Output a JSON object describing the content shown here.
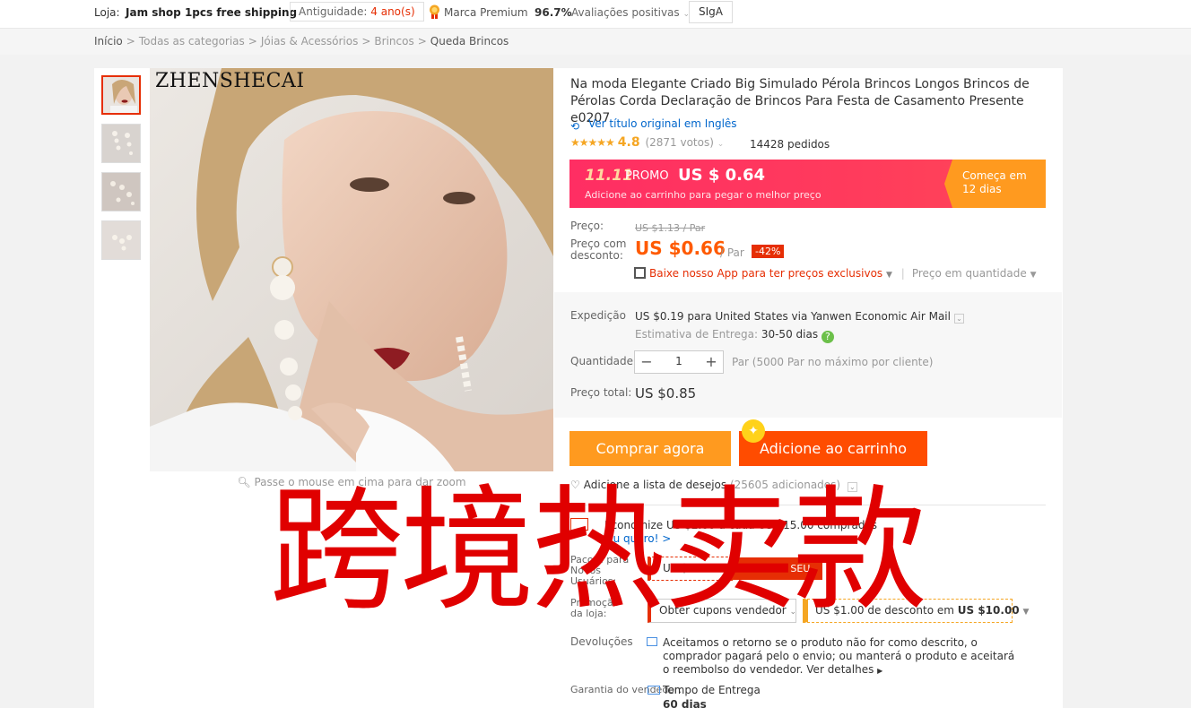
{
  "store_bar": {
    "store_label": "Loja:",
    "store_name": "Jam shop 1pcs free shipping",
    "age_label": "Antiguidade:",
    "age_value": "4 ano(s)",
    "premium_label": "Marca Premium",
    "positive_pct": "96.7%",
    "reviews_label": "Avaliações positivas",
    "follow_label": "SIgA"
  },
  "breadcrumb": {
    "items": [
      "Início",
      "Todas as categorias",
      "Jóias & Acessórios",
      "Brincos",
      "Queda Brincos"
    ]
  },
  "gallery": {
    "brand_text": "ZHENSHECAI",
    "zoom_hint": "Passe o mouse em cima para dar zoom"
  },
  "product": {
    "title": "Na moda Elegante Criado Big Simulado Pérola Brincos Longos Brincos de Pérolas Corda Declaração de Brincos Para Festa de Casamento Presente e0207",
    "translate_link": "Ver título original em Inglês",
    "stars": "★★★★★",
    "rating": "4.8",
    "votes": "(2871 votos)",
    "orders": "14428 pedidos"
  },
  "promo": {
    "badge": "11.11",
    "label": "PROMO",
    "price": "US $ 0.64",
    "subtext": "Adicione ao carrinho para pegar o melhor preço",
    "starts_line1": "Começa em",
    "starts_line2": "12 dias"
  },
  "pricing": {
    "price_label": "Preço:",
    "original_price": "US $1.13 / Par",
    "discount_label": "Preço com desconto:",
    "discount_price": "US $0.66",
    "per_unit": "/ Par",
    "discount_pct": "-42%",
    "app_promo": "Baixe nosso App para ter preços exclusivos",
    "bulk_price": "Preço em quantidade"
  },
  "shipping": {
    "label": "Expedição",
    "cost": "US $0.19 para",
    "destination": "United States via Yanwen Economic Air Mail",
    "estimate_label": "Estimativa de Entrega:",
    "estimate_days": "30-50 dias",
    "qty_label": "Quantidade",
    "qty_value": "1",
    "qty_note": "Par (5000 Par no máximo por cliente)",
    "total_label": "Preço total:",
    "total_value": "US $0.85"
  },
  "actions": {
    "buy_now": "Comprar agora",
    "add_to_cart": "Adicione ao carrinho",
    "wishlist": "Adicione a lista de desejos",
    "wishlist_count": "(25605 adicionados)"
  },
  "offers": {
    "sale_text": "Economize US $2.00 a cada US $15.00 comprados",
    "want_link": "Eu quero! >",
    "new_user_label": "Pacote para Novos Usuários:",
    "new_user_coupon": "US $100.00",
    "get_coupon": "PEGUE O SEU",
    "store_promo_label": "Promoção da loja:",
    "coupons_dropdown": "Obter cupons vendedor",
    "discount_text": "US $1.00 de desconto em",
    "discount_min": "US $10.00"
  },
  "returns": {
    "label": "Devoluções",
    "text": "Aceitamos o retorno se o produto não for como descrito, o comprador pagará pelo o envio; ou manterá o produto e aceitará o reembolso do vendedor.",
    "more": "Ver detalhes"
  },
  "guarantee": {
    "label": "Garantia do vendedor:",
    "item": "Tempo de Entrega",
    "days": "60 dias"
  },
  "watermark": "跨境热卖款",
  "colors": {
    "accent_red": "#e62e04",
    "buy_orange": "#ff9a1f",
    "cart_orange": "#ff4c00",
    "promo_pink": "#ff2e63",
    "link_blue": "#0066cc"
  }
}
